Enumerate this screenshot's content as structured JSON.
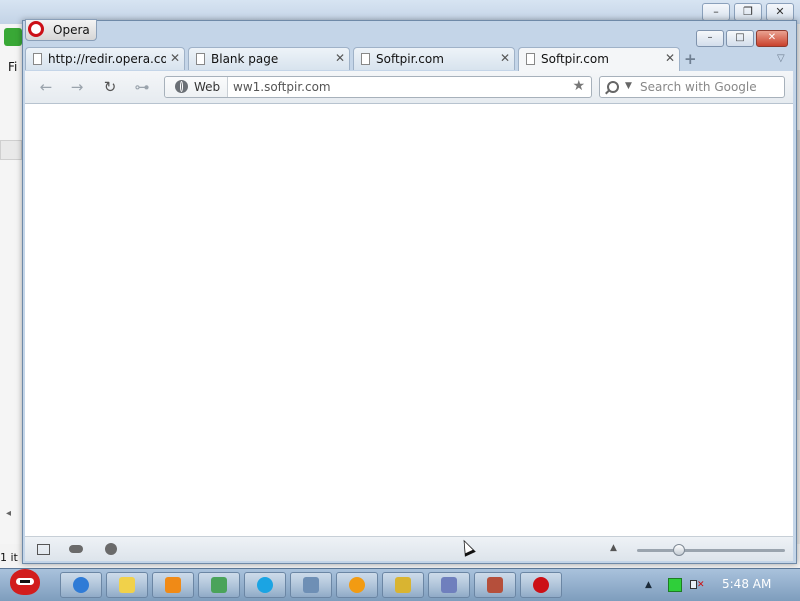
{
  "background_window": {
    "menu_fragment": "Fi",
    "status_fragment": "1 it"
  },
  "opera": {
    "menu_button_label": "Opera",
    "controls": {
      "minimize": "–",
      "maximize": "□",
      "close": "✕"
    },
    "tabs": [
      {
        "label": "http://redir.opera.co...",
        "active": false
      },
      {
        "label": "Blank page",
        "active": false
      },
      {
        "label": "Softpir.com",
        "active": false
      },
      {
        "label": "Softpir.com",
        "active": true
      }
    ],
    "tab_close_glyph": "✕",
    "add_tab_glyph": "+",
    "tab_menu_glyph": "▽",
    "nav": {
      "back": "←",
      "forward": "→",
      "reload": "↻",
      "key": "⊶",
      "address_badge": "Web",
      "address_value": "ww1.softpir.com",
      "star": "★",
      "search_placeholder": "Search with Google",
      "search_dropdown": "▼"
    },
    "status": {
      "zoom_arrow": "▲",
      "zoom_level": 0.28
    }
  },
  "taskbar": {
    "apps": [
      {
        "name": "internet-explorer",
        "color": "#2f7bd6"
      },
      {
        "name": "folder",
        "color": "#f1d14a"
      },
      {
        "name": "media-player",
        "color": "#f08a16"
      },
      {
        "name": "network",
        "color": "#4aa35a"
      },
      {
        "name": "skype",
        "color": "#1ba4e3"
      },
      {
        "name": "tools",
        "color": "#6e8fb5"
      },
      {
        "name": "download",
        "color": "#f29b12"
      },
      {
        "name": "settings",
        "color": "#d9b431"
      },
      {
        "name": "installer",
        "color": "#6f7fbd"
      },
      {
        "name": "video-editor",
        "color": "#b54f3b"
      },
      {
        "name": "opera",
        "color": "#cc0f16"
      }
    ],
    "tray_up": "▲",
    "clock": "5:48 AM"
  }
}
